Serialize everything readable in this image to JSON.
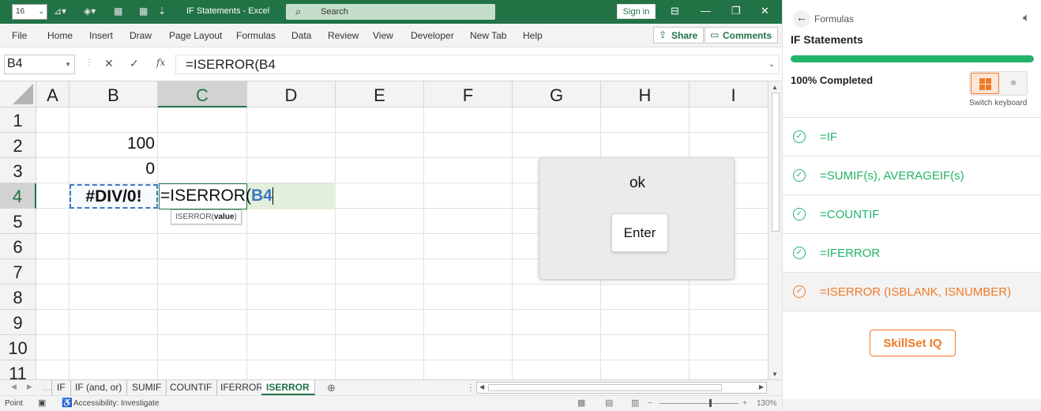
{
  "excel": {
    "font_size": "16",
    "window_title": "IF Statements  -  Excel",
    "search_placeholder": "Search",
    "sign_in": "Sign in",
    "ribbon_tabs": [
      "File",
      "Home",
      "Insert",
      "Draw",
      "Page Layout",
      "Formulas",
      "Data",
      "Review",
      "View",
      "Developer",
      "New Tab",
      "Help"
    ],
    "share": "Share",
    "comments": "Comments",
    "name_box": "B4",
    "formula": "=ISERROR(B4",
    "columns": [
      "A",
      "B",
      "C",
      "D",
      "E",
      "F",
      "G",
      "H",
      "I"
    ],
    "rows": [
      "1",
      "2",
      "3",
      "4",
      "5",
      "6",
      "7",
      "8",
      "9",
      "10",
      "11"
    ],
    "cells": {
      "B2": "100",
      "B3": "0",
      "B4": "#DIV/0!",
      "C4_prefix": "=ISERROR(",
      "C4_ref": "B4"
    },
    "tooltip_fn": "ISERROR(",
    "tooltip_arg": "value",
    "tooltip_close": ")",
    "sheets": [
      "IF",
      "IF (and, or)",
      "SUMIF",
      "COUNTIF",
      "IFERROR",
      "ISERROR"
    ],
    "active_sheet": "ISERROR",
    "status_mode": "Point",
    "status_accessibility": "Accessibility: Investigate",
    "zoom": "130%"
  },
  "dialog": {
    "message": "ok",
    "button": "Enter"
  },
  "panel": {
    "breadcrumb": "Formulas",
    "title": "IF Statements",
    "progress": 1.0,
    "progress_label": "100% Completed",
    "switch_keyboard": "Switch keyboard",
    "lessons": [
      {
        "label": "=IF",
        "active": false
      },
      {
        "label": "=SUMIF(s), AVERAGEIF(s)",
        "active": false
      },
      {
        "label": "=COUNTIF",
        "active": false
      },
      {
        "label": "=IFERROR",
        "active": false
      },
      {
        "label": "=ISERROR (ISBLANK, ISNUMBER)",
        "active": true
      }
    ],
    "skillset_button": "SkillSet IQ"
  },
  "colors": {
    "excel_green": "#217346",
    "panel_green": "#23b46a",
    "orange": "#f07a28"
  }
}
